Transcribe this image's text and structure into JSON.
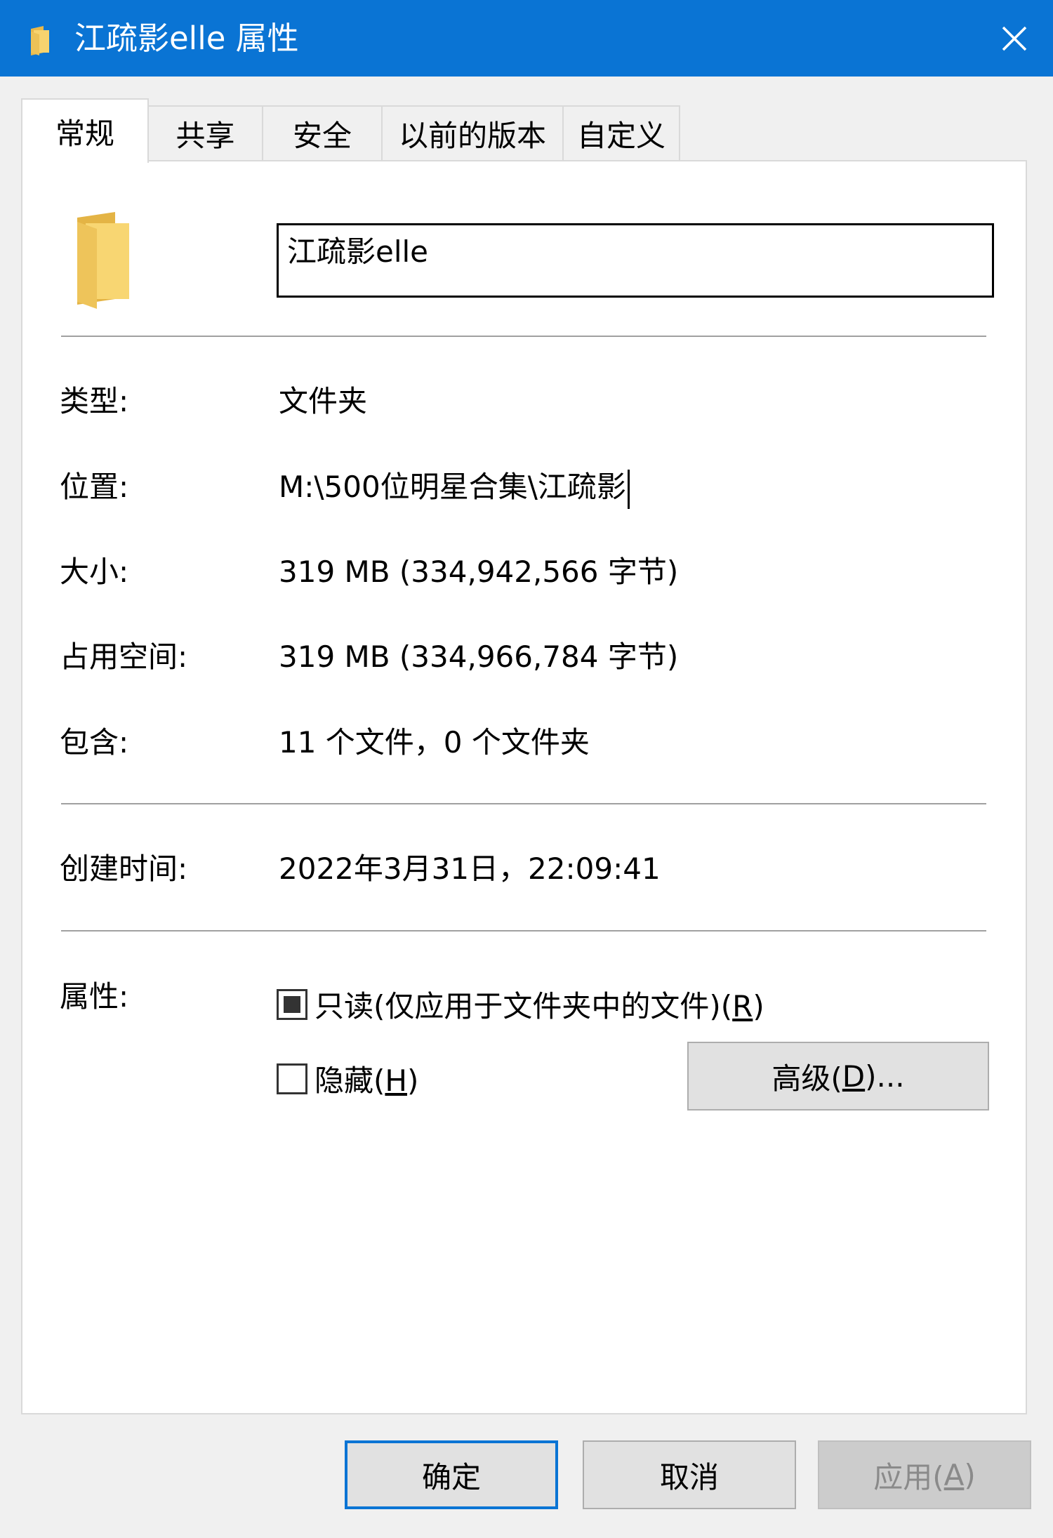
{
  "window": {
    "title": "江疏影elle 属性",
    "icon": "folder-icon"
  },
  "tabs": [
    {
      "label": "常规",
      "active": true
    },
    {
      "label": "共享",
      "active": false
    },
    {
      "label": "安全",
      "active": false
    },
    {
      "label": "以前的版本",
      "active": false
    },
    {
      "label": "自定义",
      "active": false
    }
  ],
  "general": {
    "folder_name": "江疏影elle",
    "type_label": "类型:",
    "type_value": "文件夹",
    "location_label": "位置:",
    "location_value": "M:\\500位明星合集\\江疏影",
    "size_label": "大小:",
    "size_value": "319 MB (334,942,566 字节)",
    "size_on_disk_label": "占用空间:",
    "size_on_disk_value": "319 MB (334,966,784 字节)",
    "contains_label": "包含:",
    "contains_value": "11 个文件，0 个文件夹",
    "created_label": "创建时间:",
    "created_value": "2022年3月31日，22:09:41",
    "attributes_label": "属性:",
    "readonly_label": "只读(仅应用于文件夹中的文件)(",
    "readonly_key": "R",
    "readonly_close": ")",
    "readonly_state": "indeterminate",
    "hidden_label": "隐藏(",
    "hidden_key": "H",
    "hidden_close": ")",
    "hidden_checked": false,
    "advanced_label": "高级(",
    "advanced_key": "D",
    "advanced_close": ")..."
  },
  "buttons": {
    "ok": "确定",
    "cancel": "取消",
    "apply_label": "应用(",
    "apply_key": "A",
    "apply_close": ")"
  },
  "colors": {
    "titlebar": "#0a74d4",
    "folder": "#f5cf68"
  }
}
